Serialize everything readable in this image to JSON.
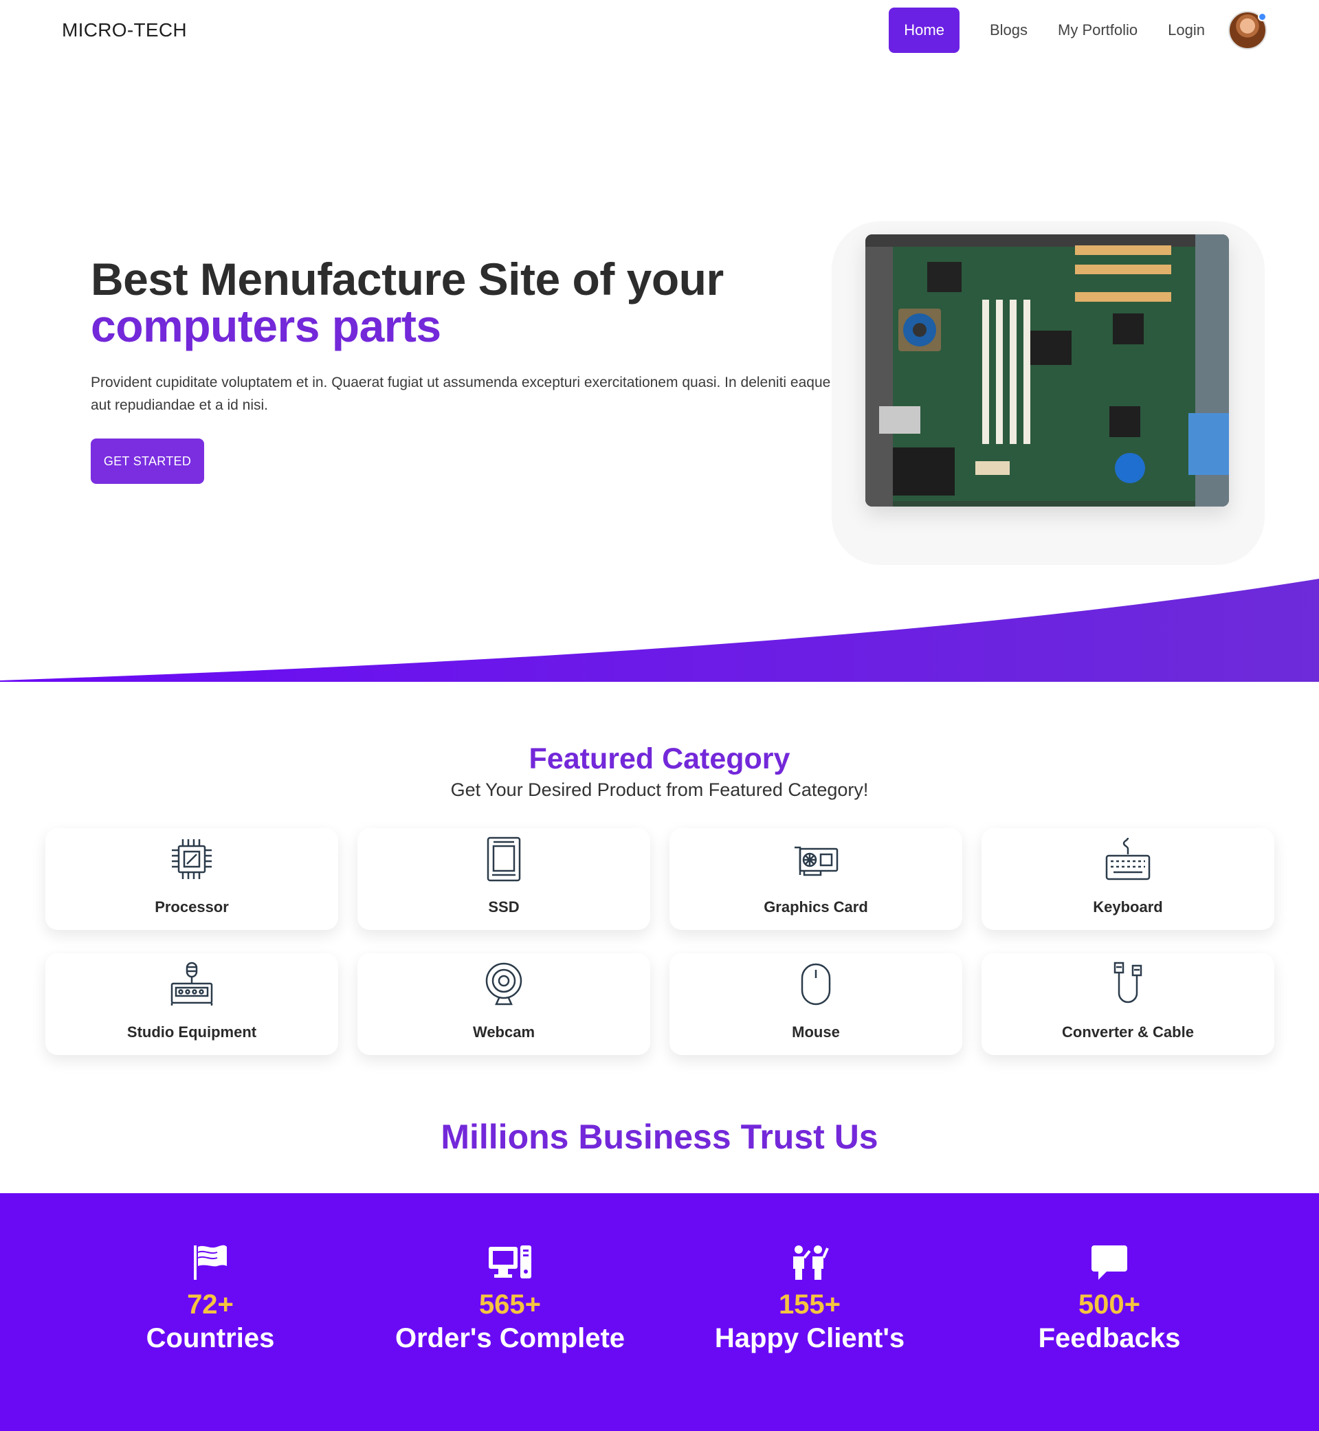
{
  "navbar": {
    "brand": "MICRO-TECH",
    "links": [
      "Home",
      "Blogs",
      "My Portfolio",
      "Login"
    ]
  },
  "hero": {
    "title_line1": "Best Menufacture Site of your",
    "title_line2": "computers parts",
    "description": "Provident cupiditate voluptatem et in. Quaerat fugiat ut assumenda excepturi exercitationem quasi. In deleniti eaque aut repudiandae et a id nisi.",
    "cta": "GET STARTED"
  },
  "featured": {
    "title": "Featured Category",
    "subtitle": "Get Your Desired Product from Featured Category!",
    "categories": [
      {
        "label": "Processor",
        "icon": "processor-icon"
      },
      {
        "label": "SSD",
        "icon": "ssd-icon"
      },
      {
        "label": "Graphics Card",
        "icon": "graphics-card-icon"
      },
      {
        "label": "Keyboard",
        "icon": "keyboard-icon"
      },
      {
        "label": "Studio Equipment",
        "icon": "studio-equipment-icon"
      },
      {
        "label": "Webcam",
        "icon": "webcam-icon"
      },
      {
        "label": "Mouse",
        "icon": "mouse-icon"
      },
      {
        "label": "Converter & Cable",
        "icon": "cable-icon"
      }
    ]
  },
  "trust_title": "Millions Business Trust Us",
  "stats": [
    {
      "value": "72+",
      "label": "Countries",
      "icon": "flag-icon"
    },
    {
      "value": "565+",
      "label": "Order's Complete",
      "icon": "computer-icon"
    },
    {
      "value": "155+",
      "label": "Happy Client's",
      "icon": "people-icon"
    },
    {
      "value": "500+",
      "label": "Feedbacks",
      "icon": "chat-icon"
    }
  ],
  "colors": {
    "accent": "#7328d9",
    "button": "#6b21e3",
    "stats_bg": "#6a0af5",
    "stats_number": "#f6c440"
  }
}
